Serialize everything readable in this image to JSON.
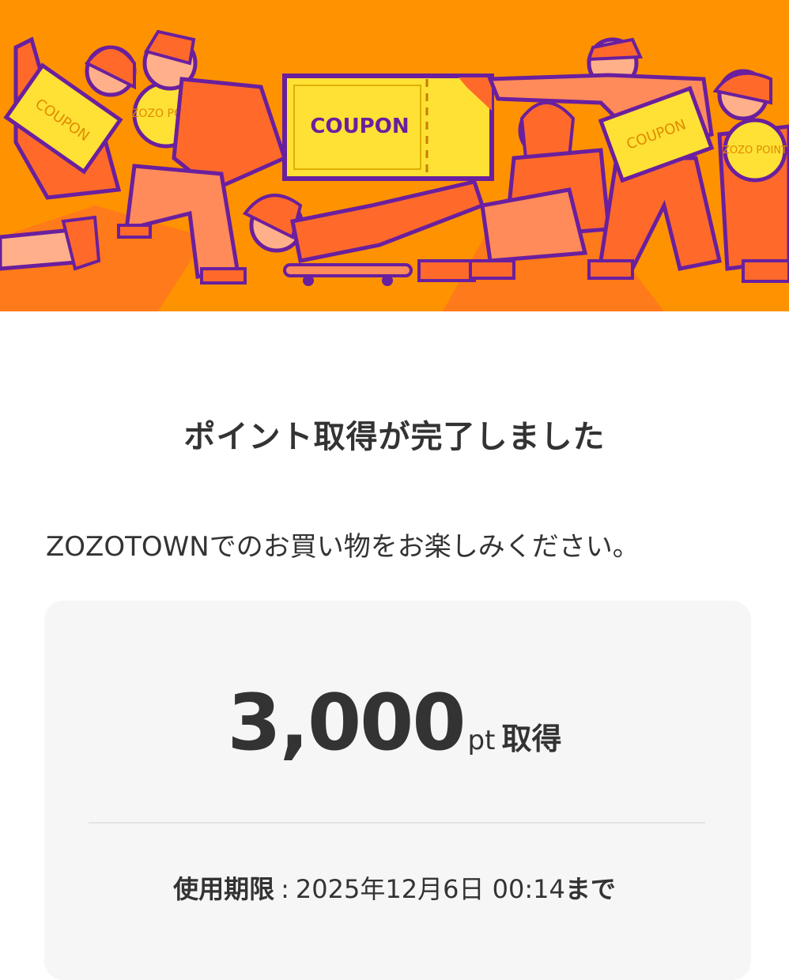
{
  "banner": {
    "coupon_label": "COUPON",
    "coupon_small_1": "COUPON",
    "coupon_small_2": "COUPON",
    "zozo_point_1": "ZOZO POINT",
    "zozo_point_2": "ZOZO POINT",
    "colors": {
      "background": "#ff9200",
      "ticket": "#ffe135",
      "outline": "#6a1f9e",
      "figure": "#ff6a2a",
      "skin": "#ffb08a"
    }
  },
  "title": "ポイント取得が完了しました",
  "message": "ZOZOTOWNでのお買い物をお楽しみください。",
  "points": {
    "value": "3,000",
    "unit": "pt",
    "suffix": "取得"
  },
  "expiry": {
    "label": "使用期限",
    "separator": ":",
    "date": "2025年12月6日 00:14",
    "until": "まで"
  }
}
